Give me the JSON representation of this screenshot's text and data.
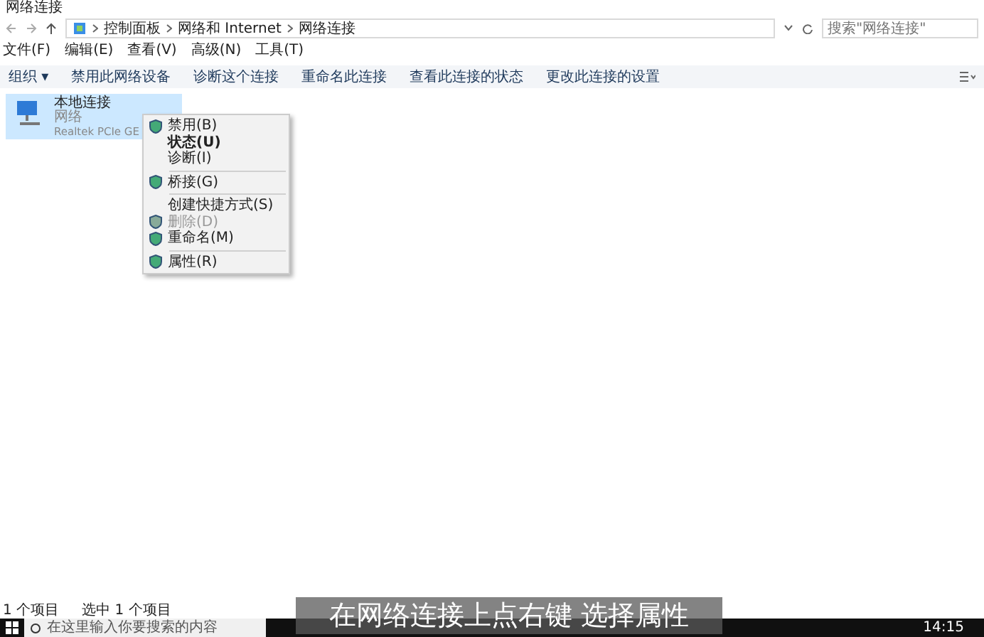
{
  "window": {
    "title": "网络连接"
  },
  "address": {
    "breadcrumb": [
      "控制面板",
      "网络和 Internet",
      "网络连接"
    ],
    "search_placeholder": "搜索\"网络连接\""
  },
  "menu_bar": [
    "文件(F)",
    "编辑(E)",
    "查看(V)",
    "高级(N)",
    "工具(T)"
  ],
  "toolbar": [
    "组织 ▾",
    "禁用此网络设备",
    "诊断这个连接",
    "重命名此连接",
    "查看此连接的状态",
    "更改此连接的设置"
  ],
  "connections": [
    {
      "name": "本地连接",
      "network": "网络",
      "adapter": "Realtek PCIe GE",
      "selected": true
    }
  ],
  "context_menu": [
    {
      "kind": "item",
      "label": "禁用(B)",
      "shield": true,
      "default": false,
      "disabled": false
    },
    {
      "kind": "item",
      "label": "状态(U)",
      "shield": false,
      "default": true,
      "disabled": false
    },
    {
      "kind": "item",
      "label": "诊断(I)",
      "shield": false,
      "default": false,
      "disabled": false
    },
    {
      "kind": "separator"
    },
    {
      "kind": "item",
      "label": "桥接(G)",
      "shield": true,
      "default": false,
      "disabled": false
    },
    {
      "kind": "separator"
    },
    {
      "kind": "item",
      "label": "创建快捷方式(S)",
      "shield": false,
      "default": false,
      "disabled": false
    },
    {
      "kind": "item",
      "label": "删除(D)",
      "shield": true,
      "default": false,
      "disabled": true
    },
    {
      "kind": "item",
      "label": "重命名(M)",
      "shield": true,
      "default": false,
      "disabled": false
    },
    {
      "kind": "separator"
    },
    {
      "kind": "item",
      "label": "属性(R)",
      "shield": true,
      "default": false,
      "disabled": false
    }
  ],
  "status_bar": [
    "1 个项目",
    "选中 1 个项目"
  ],
  "taskbar": {
    "search_placeholder": "在这里输入你要搜索的内容",
    "time": "14:15"
  },
  "subtitle": "在网络连接上点右键 选择属性"
}
